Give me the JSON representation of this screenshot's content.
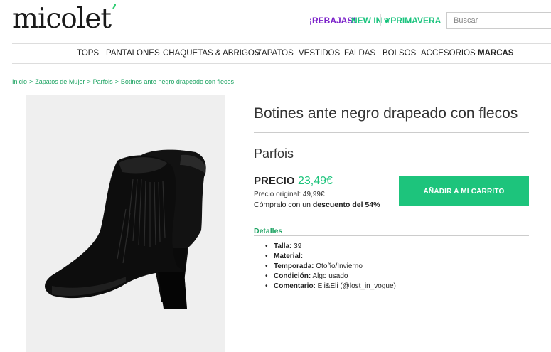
{
  "header": {
    "logo": "micolet",
    "promos": [
      {
        "label": "¡REBAJAS!"
      },
      {
        "label": "NEW IN"
      },
      {
        "label": "PRIMAVERA",
        "icon": "leaf-icon"
      }
    ],
    "search_placeholder": "Buscar"
  },
  "nav": {
    "items": [
      "TOPS",
      "PANTALONES",
      "CHAQUETAS & ABRIGOS",
      "ZAPATOS",
      "VESTIDOS",
      "FALDAS",
      "BOLSOS",
      "ACCESORIOS",
      "MARCAS"
    ]
  },
  "breadcrumb": {
    "items": [
      "Inicio",
      "Zapatos de Mujer",
      "Parfois",
      "Botines ante negro drapeado con flecos"
    ],
    "separator": ">"
  },
  "product": {
    "title": "Botines ante negro drapeado con flecos",
    "brand": "Parfois",
    "price_label": "PRECIO",
    "price": "23,49€",
    "original_price": "Precio original: 49,99€",
    "discount_prefix": "Cómpralo con un ",
    "discount_value": "descuento del 54%",
    "add_to_cart": "AÑADIR A MI CARRITO"
  },
  "details": {
    "title": "Detalles",
    "items": [
      {
        "key": "Talla:",
        "value": " 39"
      },
      {
        "key": "Material:",
        "value": ""
      },
      {
        "key": "Temporada:",
        "value": " Otoño/Invierno"
      },
      {
        "key": "Condición:",
        "value": " Algo usado"
      },
      {
        "key": "Comentario:",
        "value": " Eli&Eli (@lost_in_vogue)"
      }
    ]
  },
  "colors": {
    "accent": "#1dc47c",
    "rebajas": "#7a20c9",
    "image_bg": "#efefef"
  }
}
